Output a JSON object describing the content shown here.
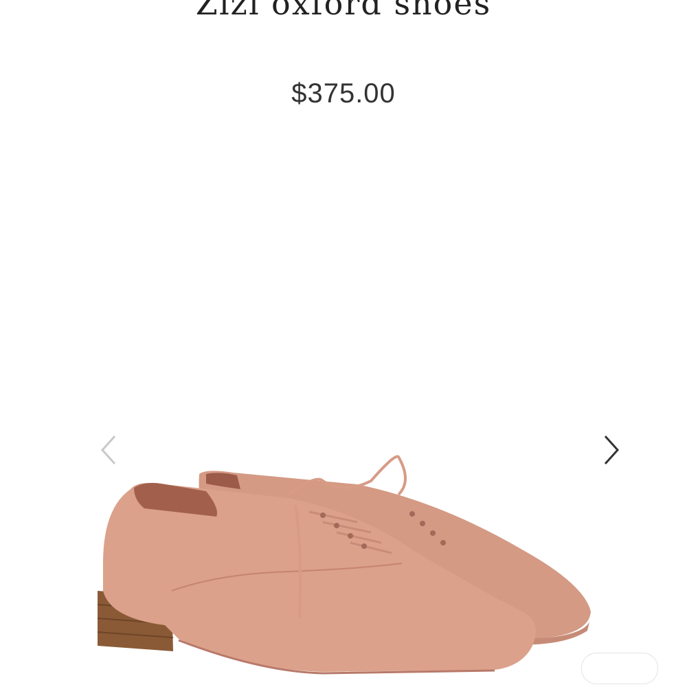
{
  "product": {
    "title": "Zizi oxford shoes",
    "price": "$375.00"
  },
  "gallery": {
    "prev_icon": "chevron-left-icon",
    "next_icon": "chevron-right-icon"
  },
  "colors": {
    "leather": "#d9a08a",
    "heel": "#8a5a36",
    "text": "#222222"
  }
}
